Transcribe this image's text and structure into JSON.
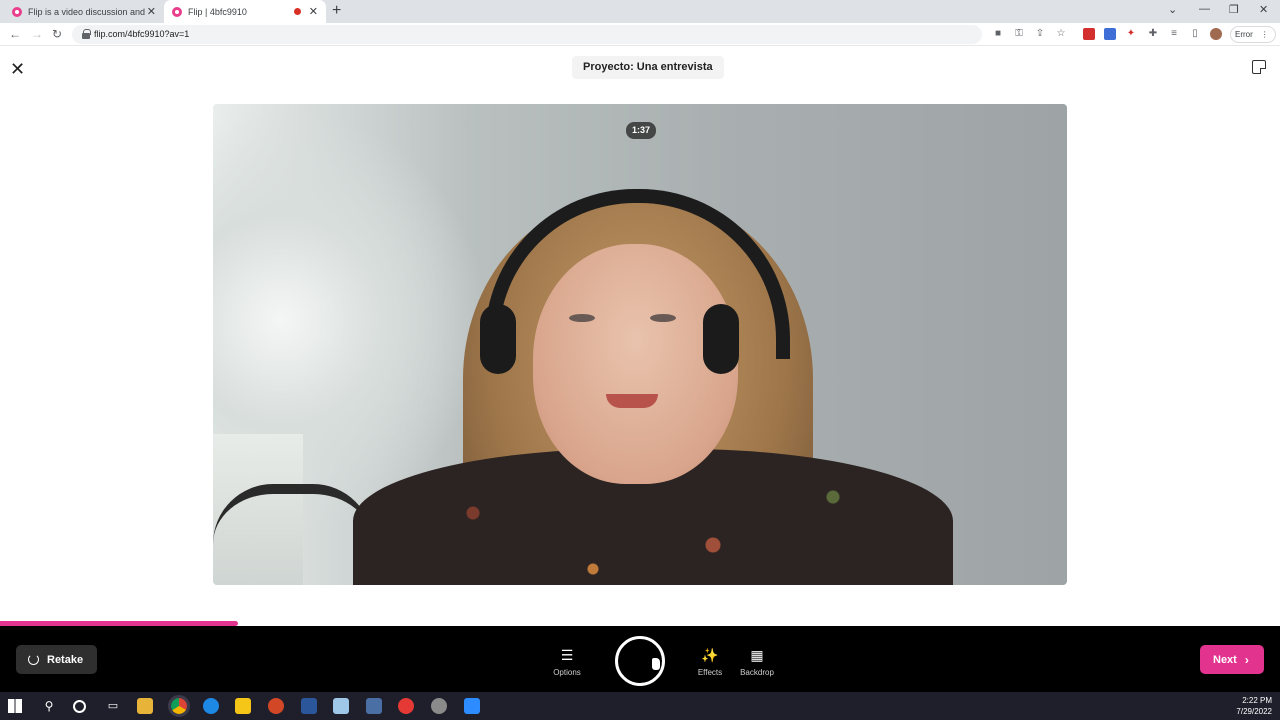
{
  "browser": {
    "tabs": [
      {
        "title": "Flip is a video discussion and sha",
        "active": false
      },
      {
        "title": "Flip | 4bfc9910",
        "active": true,
        "recording": true
      }
    ],
    "new_tab_label": "+",
    "url": "flip.com/4bfc9910?av=1",
    "profile_status": "Error"
  },
  "header": {
    "project_title": "Proyecto: Una entrevista"
  },
  "video": {
    "timer": "1:37",
    "progress_fraction": 0.186
  },
  "recorder": {
    "retake_label": "Retake",
    "tools": [
      {
        "name": "options",
        "label": "Options",
        "icon": "sliders-icon"
      },
      {
        "name": "effects",
        "label": "Effects",
        "icon": "magic-wand-icon"
      },
      {
        "name": "backdrop",
        "label": "Backdrop",
        "icon": "backdrop-icon"
      }
    ],
    "next_label": "Next"
  },
  "colors": {
    "accent": "#e2338f",
    "recorder_bg": "#000000"
  },
  "taskbar": {
    "time": "2:22 PM",
    "date": "7/29/2022"
  }
}
